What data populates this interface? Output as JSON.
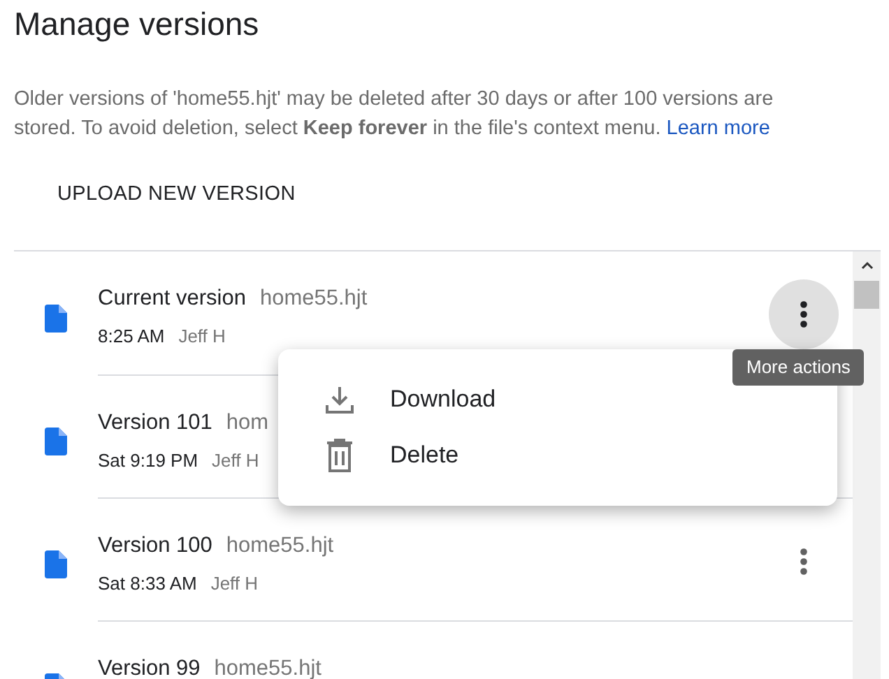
{
  "title": "Manage versions",
  "description": "Older versions of 'home55.hjt' may be deleted after 30 days or after 100 versions are stored. To avoid deletion, select **Keep forever** in the file's context menu.",
  "learn_more": "Learn more",
  "upload_button": "UPLOAD NEW VERSION",
  "versions": [
    {
      "name": "Current version",
      "file": "home55.hjt",
      "time": "8:25 AM",
      "author": "Jeff H",
      "menu_active": true
    },
    {
      "name": "Version 101",
      "file": "hom",
      "time": "Sat 9:19 PM",
      "author": "Jeff H"
    },
    {
      "name": "Version 100",
      "file": "home55.hjt",
      "time": "Sat 8:33 AM",
      "author": "Jeff H",
      "menu_active": false
    },
    {
      "name": "Version 99",
      "file": "home55.hjt"
    }
  ],
  "menu": [
    {
      "kind": "download",
      "label": "Download"
    },
    {
      "kind": "delete",
      "label": "Delete"
    }
  ],
  "tooltip": "More actions"
}
